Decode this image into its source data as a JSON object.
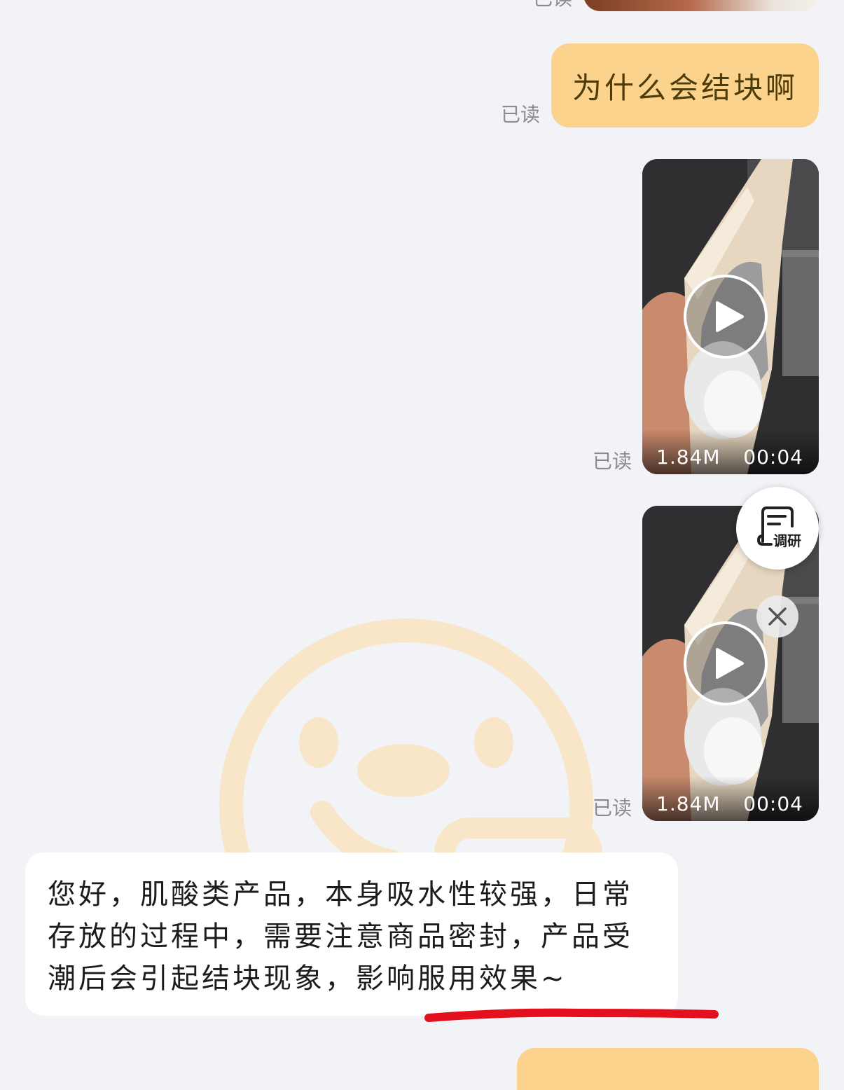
{
  "messages": {
    "top_partial": {
      "status": "已读"
    },
    "question": {
      "text": "为什么会结块啊",
      "status": "已读"
    },
    "video1": {
      "size": "1.84M",
      "duration": "00:04",
      "status": "已读"
    },
    "video2": {
      "size": "1.84M",
      "duration": "00:04",
      "status": "已读"
    },
    "reply": {
      "text": "您好，肌酸类产品，本身吸水性较强，日常存放的过程中，需要注意商品密封，产品受潮后会引起结块现象，影响服用效果~"
    }
  },
  "floating": {
    "survey_label": "调研",
    "survey_icon": "survey-icon",
    "close_icon": "close-icon"
  },
  "colors": {
    "background": "#f2f3f7",
    "outgoing_bubble": "#fcd38c",
    "incoming_bubble": "#ffffff",
    "annotation_underline": "#e3101d",
    "read_status": "#8b8b8f"
  }
}
